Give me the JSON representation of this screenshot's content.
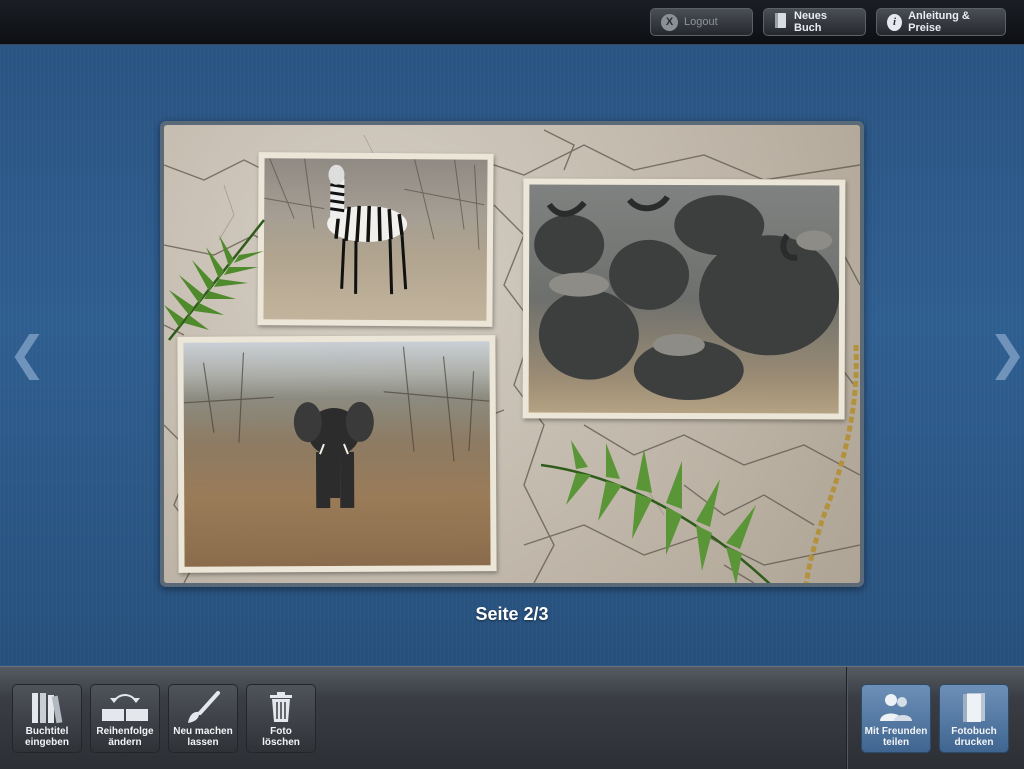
{
  "topbar": {
    "logout": {
      "icon": "x-icon",
      "label": "Logout"
    },
    "new_book": {
      "icon": "book-icon",
      "label": "Neues Buch"
    },
    "guide": {
      "icon": "info-icon",
      "label": "Anleitung & Preise"
    }
  },
  "stage": {
    "prev_arrow": "❮",
    "next_arrow": "❯",
    "page_label": "Seite 2/3"
  },
  "toolbar": {
    "left": [
      {
        "icon": "books-icon",
        "label_line1": "Buchtitel",
        "label_line2": "eingeben"
      },
      {
        "icon": "swap-icon",
        "label_line1": "Reihenfolge",
        "label_line2": "ändern"
      },
      {
        "icon": "brush-icon",
        "label_line1": "Neu machen",
        "label_line2": "lassen"
      },
      {
        "icon": "trash-icon",
        "label_line1": "Foto",
        "label_line2": "löschen"
      }
    ],
    "right": [
      {
        "icon": "friends-icon",
        "label_line1": "Mit Freunden",
        "label_line2": "teilen"
      },
      {
        "icon": "photobook-icon",
        "label_line1": "Fotobuch",
        "label_line2": "drucken"
      }
    ]
  },
  "colors": {
    "stage_blue": "#2c5887",
    "highlight_button": "#5b80a8"
  }
}
